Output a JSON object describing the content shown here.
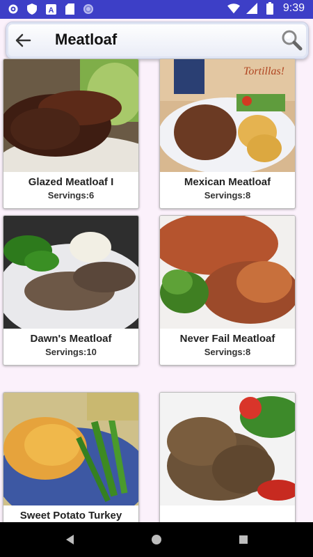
{
  "status_bar": {
    "time": "9:39"
  },
  "search": {
    "query": "Meatloaf"
  },
  "recipes": [
    {
      "title": "Glazed Meatloaf I",
      "servings": "Servings:6"
    },
    {
      "title": "Mexican Meatloaf",
      "servings": "Servings:8"
    },
    {
      "title": "Dawn's Meatloaf",
      "servings": "Servings:10"
    },
    {
      "title": "Never Fail Meatloaf",
      "servings": "Servings:8"
    },
    {
      "title": "Sweet Potato Turkey",
      "servings": ""
    },
    {
      "title": "",
      "servings": ""
    }
  ],
  "colors": {
    "status_bar": "#3d3fc7",
    "background": "#fbf1fb",
    "nav_bar": "#000000"
  }
}
